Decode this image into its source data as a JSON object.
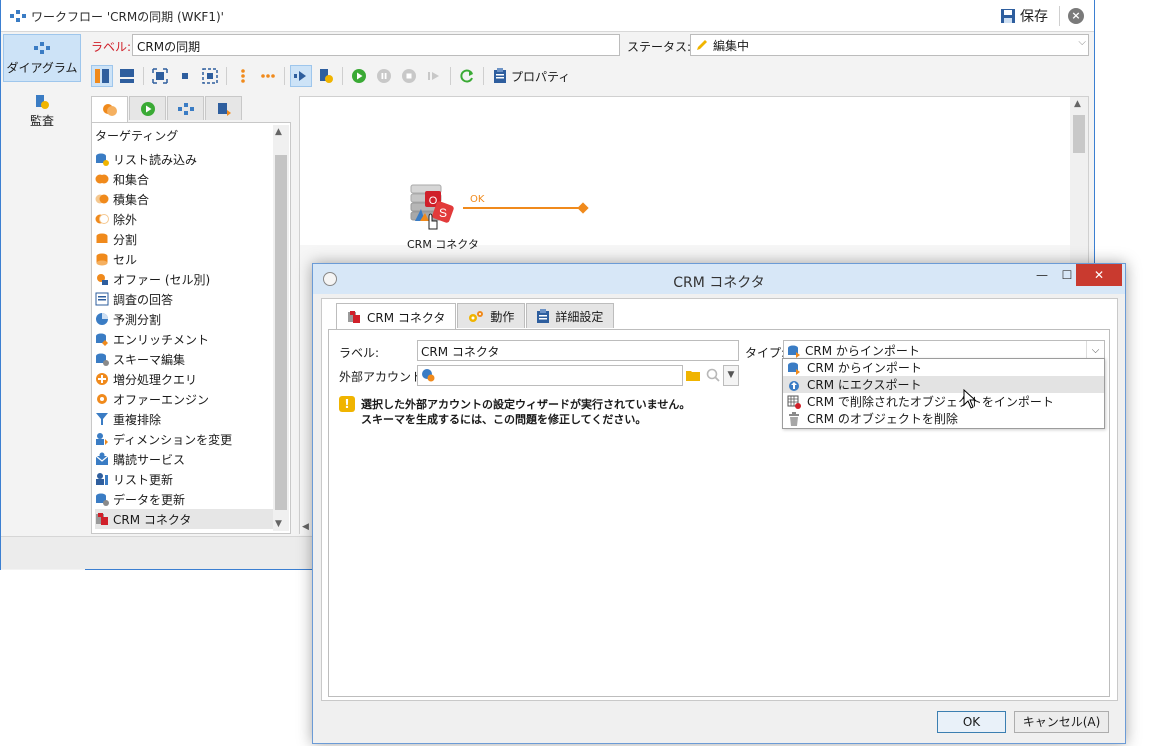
{
  "window": {
    "title": "ワークフロー 'CRMの同期 (WKF1)'",
    "save_label": "保存"
  },
  "nav": {
    "diagram_label": "ダイアグラム",
    "audit_label": "監査"
  },
  "form": {
    "label_caption": "ラベル:",
    "label_value": "CRMの同期",
    "status_caption": "ステータス:",
    "status_value": "編集中"
  },
  "toolbar": {
    "properties_label": "プロパティ"
  },
  "palette": {
    "header": "ターゲティング",
    "items": [
      {
        "label": "リスト読み込み",
        "icon": "list-read-icon",
        "color": "#3a7cc4"
      },
      {
        "label": "和集合",
        "icon": "union-icon",
        "color": "#f08a1c"
      },
      {
        "label": "積集合",
        "icon": "intersection-icon",
        "color": "#f08a1c"
      },
      {
        "label": "除外",
        "icon": "exclusion-icon",
        "color": "#f08a1c"
      },
      {
        "label": "分割",
        "icon": "split-icon",
        "color": "#f08a1c"
      },
      {
        "label": "セル",
        "icon": "cell-icon",
        "color": "#f08a1c"
      },
      {
        "label": "オファー (セル別)",
        "icon": "offer-by-cell-icon",
        "color": "#f08a1c"
      },
      {
        "label": "調査の回答",
        "icon": "survey-answer-icon",
        "color": "#3a7cc4"
      },
      {
        "label": "予測分割",
        "icon": "predictive-split-icon",
        "color": "#3a7cc4"
      },
      {
        "label": "エンリッチメント",
        "icon": "enrichment-icon",
        "color": "#3a7cc4"
      },
      {
        "label": "スキーマ編集",
        "icon": "schema-edit-icon",
        "color": "#3a7cc4"
      },
      {
        "label": "増分処理クエリ",
        "icon": "incremental-query-icon",
        "color": "#f08a1c"
      },
      {
        "label": "オファーエンジン",
        "icon": "offer-engine-icon",
        "color": "#f08a1c"
      },
      {
        "label": "重複排除",
        "icon": "deduplication-icon",
        "color": "#3a7cc4"
      },
      {
        "label": "ディメンションを変更",
        "icon": "change-dimension-icon",
        "color": "#3a7cc4"
      },
      {
        "label": "購読サービス",
        "icon": "subscription-service-icon",
        "color": "#3a7cc4"
      },
      {
        "label": "リスト更新",
        "icon": "list-update-icon",
        "color": "#3a7cc4"
      },
      {
        "label": "データを更新",
        "icon": "update-data-icon",
        "color": "#3a7cc4"
      },
      {
        "label": "CRM コネクタ",
        "icon": "crm-connector-icon",
        "color": "#d0202a"
      }
    ]
  },
  "canvas": {
    "node_label": "CRM コネクタ",
    "transition_label": "OK"
  },
  "dialog": {
    "title": "CRM コネクタ",
    "tabs": [
      {
        "label": "CRM コネクタ",
        "icon": "crm-connector-icon"
      },
      {
        "label": "動作",
        "icon": "gears-icon"
      },
      {
        "label": "詳細設定",
        "icon": "clipboard-icon"
      }
    ],
    "label_caption": "ラベル:",
    "label_value": "CRM コネクタ",
    "account_caption": "外部アカウント:",
    "type_caption": "タイプ:",
    "type_value": "CRM からインポート",
    "warning_line1": "選択した外部アカウントの設定ウィザードが実行されていません。",
    "warning_line2": "スキーマを生成するには、この問題を修正してください。",
    "type_options": [
      "CRM からインポート",
      "CRM にエクスポート",
      "CRM で削除されたオブジェクトをインポート",
      "CRM のオブジェクトを削除"
    ],
    "ok_label": "OK",
    "cancel_label": "キャンセル(A)"
  },
  "colors": {
    "accent": "#3a7cc4",
    "transition": "#f08a1c",
    "label_required": "#d0202a",
    "close_button": "#c93a2f"
  }
}
